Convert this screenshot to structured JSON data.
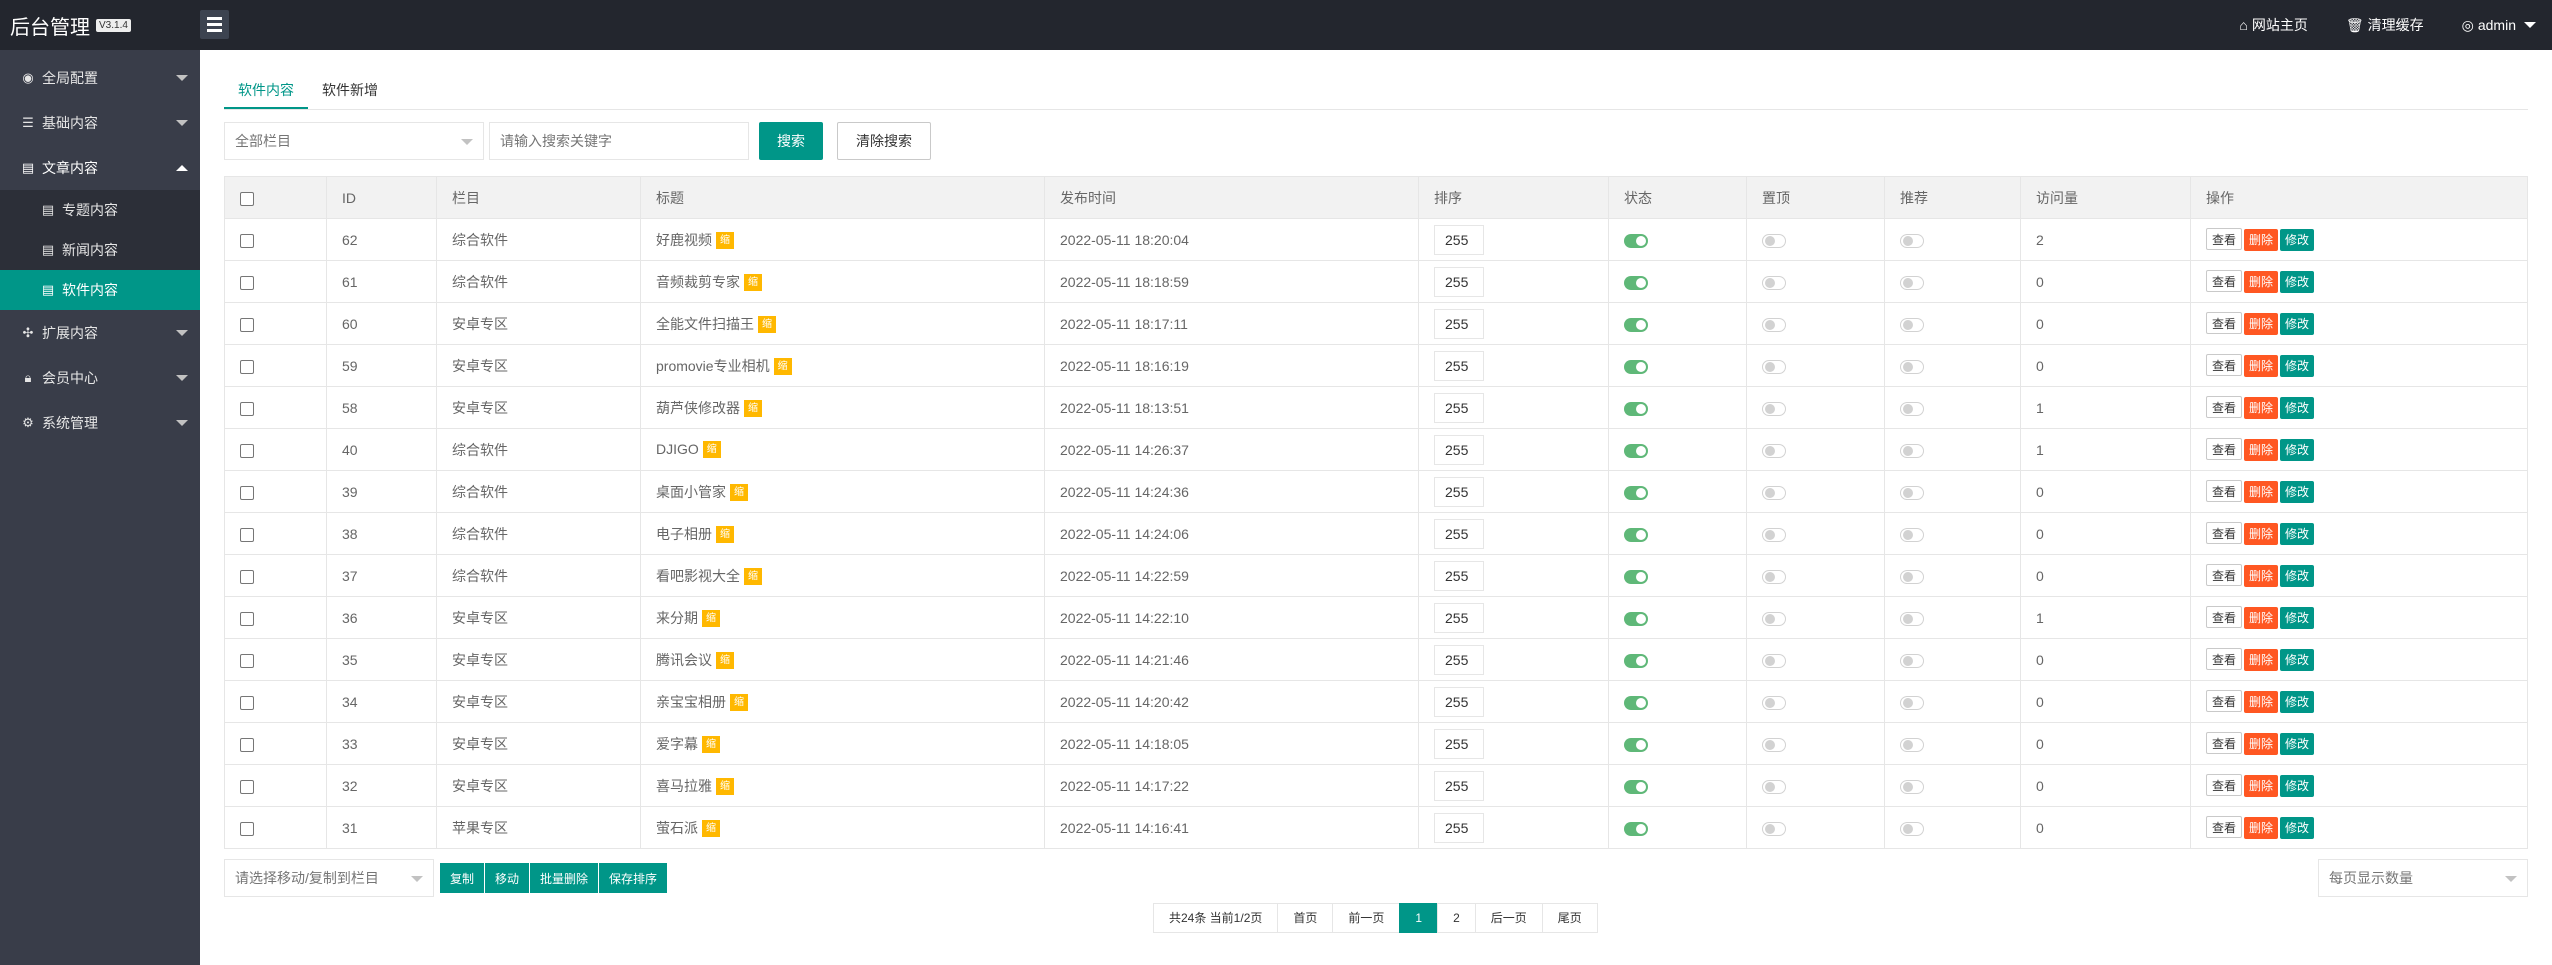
{
  "brand": {
    "title": "后台管理",
    "version": "V3.1.4"
  },
  "sidebar": {
    "items": [
      {
        "label": "全局配置",
        "icon": "dashboard-icon"
      },
      {
        "label": "基础内容",
        "icon": "sliders-icon"
      },
      {
        "label": "文章内容",
        "icon": "document-icon"
      },
      {
        "label": "扩展内容",
        "icon": "puzzle-icon"
      },
      {
        "label": "会员中心",
        "icon": "lock-icon"
      },
      {
        "label": "系统管理",
        "icon": "gear-icon"
      }
    ],
    "sub_items": [
      {
        "label": "专题内容",
        "icon": "document-icon"
      },
      {
        "label": "新闻内容",
        "icon": "document-icon"
      },
      {
        "label": "软件内容",
        "icon": "document-icon"
      }
    ]
  },
  "header": {
    "home_label": "网站主页",
    "cache_label": "清理缓存",
    "user_label": "admin"
  },
  "tabs": [
    "软件内容",
    "软件新增"
  ],
  "filter": {
    "category_select": "全部栏目",
    "search_placeholder": "请输入搜索关键字",
    "search_button": "搜索",
    "clear_button": "清除搜索"
  },
  "table": {
    "headers": [
      "ID",
      "栏目",
      "标题",
      "发布时间",
      "排序",
      "状态",
      "置顶",
      "推荐",
      "访问量",
      "操作"
    ],
    "tag_label": "缩",
    "actions": {
      "view": "查看",
      "delete": "删除",
      "edit": "修改"
    },
    "rows": [
      {
        "id": "62",
        "category": "综合软件",
        "title": "好鹿视频",
        "time": "2022-05-11 18:20:04",
        "sort": "255",
        "status": true,
        "top": false,
        "recommend": false,
        "visits": "2"
      },
      {
        "id": "61",
        "category": "综合软件",
        "title": "音频裁剪专家",
        "time": "2022-05-11 18:18:59",
        "sort": "255",
        "status": true,
        "top": false,
        "recommend": false,
        "visits": "0"
      },
      {
        "id": "60",
        "category": "安卓专区",
        "title": "全能文件扫描王",
        "time": "2022-05-11 18:17:11",
        "sort": "255",
        "status": true,
        "top": false,
        "recommend": false,
        "visits": "0"
      },
      {
        "id": "59",
        "category": "安卓专区",
        "title": "promovie专业相机",
        "time": "2022-05-11 18:16:19",
        "sort": "255",
        "status": true,
        "top": false,
        "recommend": false,
        "visits": "0"
      },
      {
        "id": "58",
        "category": "安卓专区",
        "title": "葫芦侠修改器",
        "time": "2022-05-11 18:13:51",
        "sort": "255",
        "status": true,
        "top": false,
        "recommend": false,
        "visits": "1"
      },
      {
        "id": "40",
        "category": "综合软件",
        "title": "DJIGO",
        "time": "2022-05-11 14:26:37",
        "sort": "255",
        "status": true,
        "top": false,
        "recommend": false,
        "visits": "1"
      },
      {
        "id": "39",
        "category": "综合软件",
        "title": "桌面小管家",
        "time": "2022-05-11 14:24:36",
        "sort": "255",
        "status": true,
        "top": false,
        "recommend": false,
        "visits": "0"
      },
      {
        "id": "38",
        "category": "综合软件",
        "title": "电子相册",
        "time": "2022-05-11 14:24:06",
        "sort": "255",
        "status": true,
        "top": false,
        "recommend": false,
        "visits": "0"
      },
      {
        "id": "37",
        "category": "综合软件",
        "title": "看吧影视大全",
        "time": "2022-05-11 14:22:59",
        "sort": "255",
        "status": true,
        "top": false,
        "recommend": false,
        "visits": "0"
      },
      {
        "id": "36",
        "category": "安卓专区",
        "title": "来分期",
        "time": "2022-05-11 14:22:10",
        "sort": "255",
        "status": true,
        "top": false,
        "recommend": false,
        "visits": "1"
      },
      {
        "id": "35",
        "category": "安卓专区",
        "title": "腾讯会议",
        "time": "2022-05-11 14:21:46",
        "sort": "255",
        "status": true,
        "top": false,
        "recommend": false,
        "visits": "0"
      },
      {
        "id": "34",
        "category": "安卓专区",
        "title": "亲宝宝相册",
        "time": "2022-05-11 14:20:42",
        "sort": "255",
        "status": true,
        "top": false,
        "recommend": false,
        "visits": "0"
      },
      {
        "id": "33",
        "category": "安卓专区",
        "title": "爱字幕",
        "time": "2022-05-11 14:18:05",
        "sort": "255",
        "status": true,
        "top": false,
        "recommend": false,
        "visits": "0"
      },
      {
        "id": "32",
        "category": "安卓专区",
        "title": "喜马拉雅",
        "time": "2022-05-11 14:17:22",
        "sort": "255",
        "status": true,
        "top": false,
        "recommend": false,
        "visits": "0"
      },
      {
        "id": "31",
        "category": "苹果专区",
        "title": "萤石派",
        "time": "2022-05-11 14:16:41",
        "sort": "255",
        "status": true,
        "top": false,
        "recommend": false,
        "visits": "0"
      }
    ]
  },
  "bulk": {
    "move_select": "请选择移动/复制到栏目",
    "copy": "复制",
    "move": "移动",
    "batch_delete": "批量删除",
    "save_sort": "保存排序",
    "page_size_select": "每页显示数量"
  },
  "pagination": {
    "summary": "共24条 当前1/2页",
    "first": "首页",
    "prev": "前一页",
    "pages": [
      "1",
      "2"
    ],
    "current": "1",
    "next": "后一页",
    "last": "尾页"
  },
  "colors": {
    "accent": "#009688",
    "danger": "#FF5722",
    "warning": "#FFB800",
    "switch_on": "#5FB878",
    "sidebar": "#393D49",
    "topbar": "#23262E"
  }
}
